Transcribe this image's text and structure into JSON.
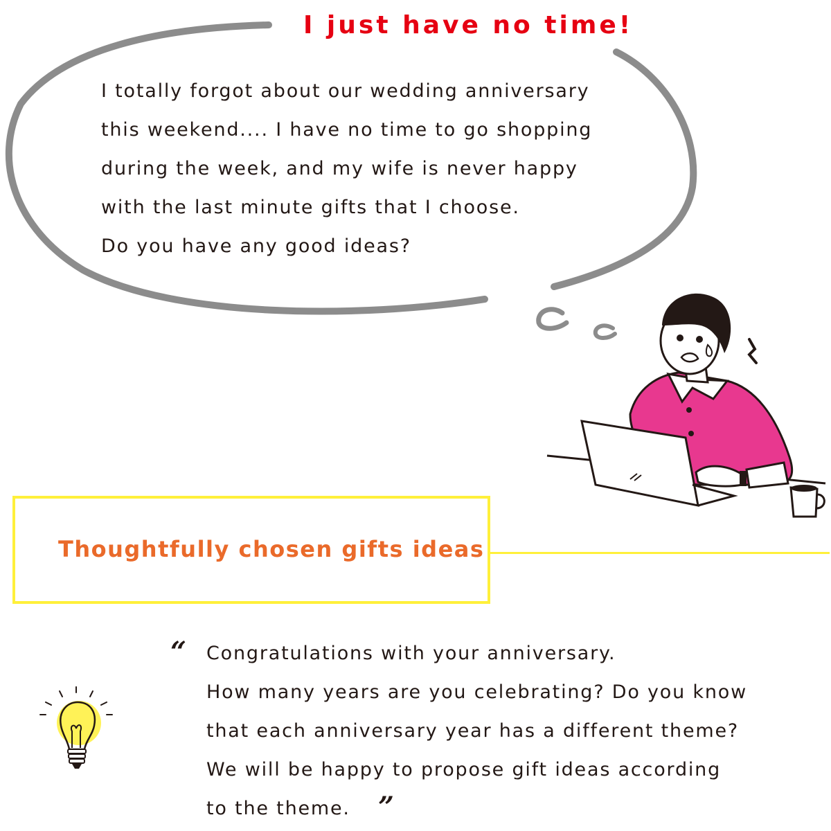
{
  "headline": "I just have no time!",
  "complaint_lines": [
    "I totally forgot about our wedding anniversary",
    "this weekend.... I have no time to go shopping",
    "during the week, and my wife is never happy",
    "with the last minute gifts that I choose.",
    "Do you have any good ideas?"
  ],
  "section_title": "Thoughtfully chosen gifts ideas",
  "quote_open": "“",
  "quote_close": "”",
  "reply_lines": [
    "Congratulations with your anniversary.",
    "How many years are you celebrating? Do you know",
    "that each anniversary year has a different theme?",
    "We will be happy to propose gift ideas according",
    "to the theme."
  ],
  "colors": {
    "headline": "#e60012",
    "section_title": "#ea6a2a",
    "box_border": "#fff03a",
    "shirt": "#e8388f",
    "bubble_stroke": "#8c8c8c",
    "bulb_glow": "#fff03a"
  },
  "illustrations": {
    "person": "worried-man-at-laptop-illustration",
    "bulb": "lightbulb-icon"
  }
}
